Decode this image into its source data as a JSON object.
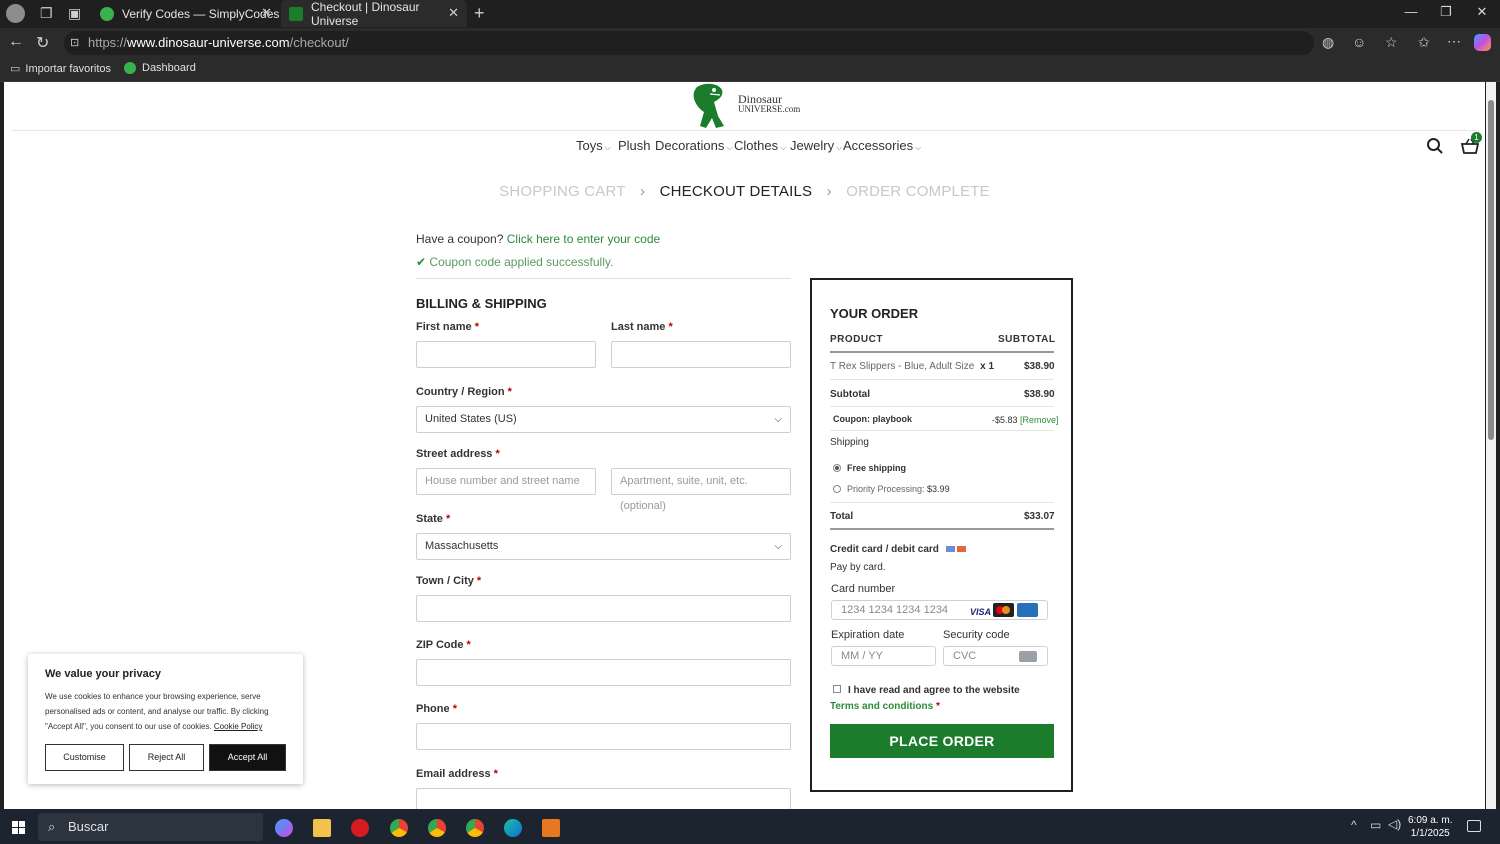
{
  "browser": {
    "tabs": [
      {
        "title": "Verify Codes — SimplyCodes",
        "active": false
      },
      {
        "title": "Checkout | Dinosaur Universe",
        "active": true
      }
    ],
    "url_prefix": "https://",
    "url_domain": "www.dinosaur-universe.com",
    "url_path": "/checkout/",
    "favorites": [
      "Importar favoritos",
      "Dashboard"
    ]
  },
  "site": {
    "logo_line1": "Dinosaur",
    "logo_line2": "UNIVERSE.com",
    "nav": [
      "Toys",
      "Plush",
      "Decorations",
      "Clothes",
      "Jewelry",
      "Accessories"
    ],
    "cart_count": "1",
    "steps": [
      "SHOPPING CART",
      "CHECKOUT DETAILS",
      "ORDER COMPLETE"
    ]
  },
  "checkout": {
    "coupon_prompt": "Have a coupon?",
    "coupon_link": "Click here to enter your code",
    "coupon_success": "Coupon code applied successfully.",
    "section_title": "BILLING & SHIPPING",
    "first_name_label": "First name",
    "last_name_label": "Last name",
    "country_label": "Country / Region",
    "country_value": "United States (US)",
    "street_label": "Street address",
    "street_placeholder_1": "House number and street name",
    "street_placeholder_2": "Apartment, suite, unit, etc. (optional)",
    "state_label": "State",
    "state_value": "Massachusetts",
    "city_label": "Town / City",
    "zip_label": "ZIP Code",
    "phone_label": "Phone",
    "email_label": "Email address",
    "required_mark": "*"
  },
  "order": {
    "title": "YOUR ORDER",
    "col_product": "PRODUCT",
    "col_subtotal": "SUBTOTAL",
    "item_name": "T Rex Slippers - Blue, Adult Size",
    "item_qty": "x 1",
    "item_price": "$38.90",
    "subtotal_label": "Subtotal",
    "subtotal_value": "$38.90",
    "coupon_label": "Coupon: playbook",
    "coupon_value": "-$5.83",
    "coupon_remove": "[Remove]",
    "shipping_label": "Shipping",
    "free_shipping": "Free shipping",
    "priority_label": "Priority Processing:",
    "priority_price": "$3.99",
    "total_label": "Total",
    "total_value": "$33.07",
    "payment_title": "Credit card / debit card",
    "payment_sub": "Pay by card.",
    "card_number_label": "Card number",
    "card_number_placeholder": "1234 1234 1234 1234",
    "expiry_label": "Expiration date",
    "expiry_placeholder": "MM / YY",
    "cvc_label": "Security code",
    "cvc_placeholder": "CVC",
    "terms_text": "I have read and agree to the website",
    "terms_link": "Terms and conditions",
    "place_order": "PLACE ORDER",
    "card_brands": [
      "VISA",
      "mastercard",
      "AMEX"
    ]
  },
  "cookie": {
    "title": "We value your privacy",
    "body": "We use cookies to enhance your browsing experience, serve personalised ads or content, and analyse our traffic. By clicking \"Accept All\", you consent to our use of cookies.",
    "policy_link": "Cookie Policy",
    "customise": "Customise",
    "reject": "Reject All",
    "accept": "Accept All"
  },
  "taskbar": {
    "search": "Buscar",
    "time": "6:09 a. m.",
    "date": "1/1/2025"
  },
  "colors": {
    "brand_green": "#1b7c2c",
    "link_green": "#2e8b3a",
    "muted_step": "#c8c8c8"
  }
}
